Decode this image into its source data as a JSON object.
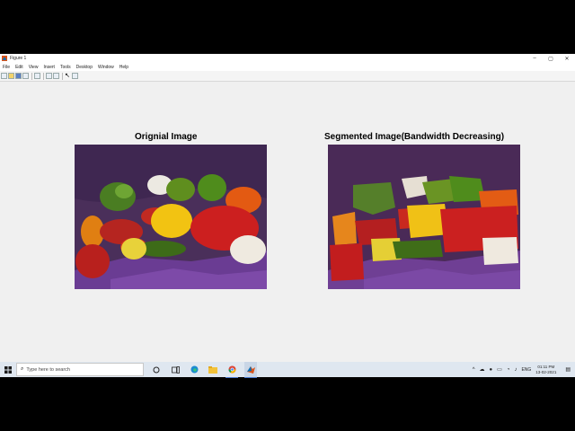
{
  "window": {
    "title": "Figure 1",
    "controls": [
      "–",
      "▢",
      "✕"
    ]
  },
  "menu": [
    "File",
    "Edit",
    "View",
    "Insert",
    "Tools",
    "Desktop",
    "Window",
    "Help"
  ],
  "toolbar": {
    "buttons": [
      "new-figure",
      "open-file",
      "save-figure",
      "print-figure",
      "print-preview",
      "link-plot",
      "insert-colorbar",
      "edit-plot",
      "dock"
    ]
  },
  "figure": {
    "left_title": "Orignial Image",
    "right_title": "Segmented Image(Bandwidth Decreasing)"
  },
  "taskbar": {
    "search_placeholder": "Type here to search",
    "language": "ENG",
    "time": "01:11 PM",
    "date": "13-02-2021",
    "pinned": [
      "cortana-icon",
      "task-view-icon",
      "edge-icon",
      "file-explorer-icon",
      "chrome-icon",
      "matlab-icon"
    ]
  }
}
